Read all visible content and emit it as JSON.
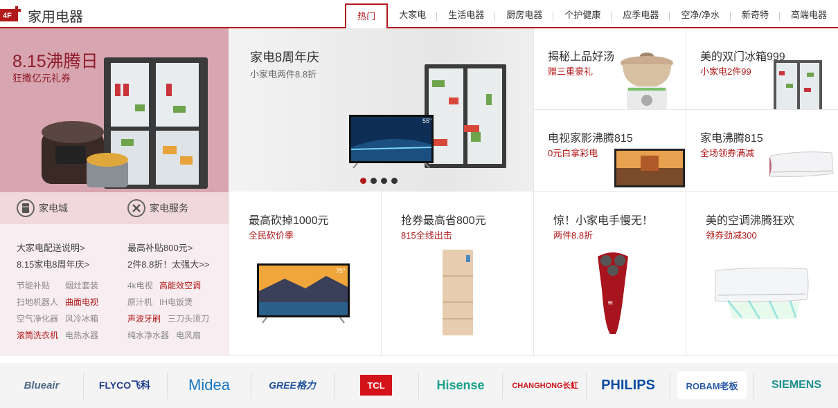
{
  "header": {
    "floor": "4F",
    "title": "家用电器",
    "tabs": [
      "热门",
      "大家电",
      "生活电器",
      "厨房电器",
      "个护健康",
      "应季电器",
      "空净/净水",
      "新奇特",
      "高端电器"
    ],
    "active_tab": "热门",
    "accent_color": "#b1191a"
  },
  "left_promo": {
    "title": "8.15沸腾日",
    "subtitle": "狂撒亿元礼券",
    "bg_color": "#d7a6b0"
  },
  "services": [
    {
      "label": "家电城",
      "icon": "fridge-icon"
    },
    {
      "label": "家电服务",
      "icon": "tools-icon"
    }
  ],
  "links": {
    "big": [
      "大家电配送说明>",
      "最高补贴800元>",
      "8.15家电8周年庆>",
      "2件8.8折！太强大>>"
    ],
    "small": [
      [
        "节能补贴",
        "烟灶套装",
        "4k电视",
        "高能效空调"
      ],
      [
        "扫地机器人",
        "曲面电视",
        "原汁机",
        "IH电饭煲"
      ],
      [
        "空气净化器",
        "风冷冰箱",
        "声波牙刷",
        "三刀头须刀"
      ],
      [
        "滚筒洗衣机",
        "电热水器",
        "纯水净水器",
        "电风扇"
      ]
    ],
    "highlighted": [
      "高能效空调",
      "曲面电视",
      "声波牙刷",
      "滚筒洗衣机"
    ]
  },
  "carousel": {
    "title": "家电8周年庆",
    "subtitle": "小家电两件8.8折",
    "tv_label": "55\"",
    "slides": 4,
    "active": 0
  },
  "small_cells": [
    {
      "title": "揭秘上品好汤",
      "sub": "赠三重豪礼",
      "image": "soup-pot"
    },
    {
      "title": "美的双门冰箱999",
      "sub": "小家电2件99",
      "image": "fridge"
    },
    {
      "title": "电视家影沸腾815",
      "sub": "0元白拿彩电",
      "image": "tv"
    },
    {
      "title": "家电沸腾815",
      "sub": "全场领券满减",
      "image": "air-conditioner"
    }
  ],
  "large_cells": [
    {
      "title": "最高砍掉1000元",
      "sub": "全民砍价季",
      "image": "tv",
      "badge": "75\""
    },
    {
      "title": "抢券最高省800元",
      "sub": "815全线出击",
      "image": "fridge"
    },
    {
      "title": "惊！小家电手慢无！",
      "sub": "两件8.8折",
      "image": "shaver"
    },
    {
      "title": "美的空调沸腾狂欢",
      "sub": "领券劲减300",
      "image": "air-conditioner"
    }
  ],
  "brands": [
    "Blueair",
    "FLYCO飞科",
    "Midea",
    "GREE格力",
    "TCL",
    "Hisense",
    "CHANGHONG长虹",
    "PHILIPS",
    "ROBAM老板",
    "SIEMENS"
  ]
}
